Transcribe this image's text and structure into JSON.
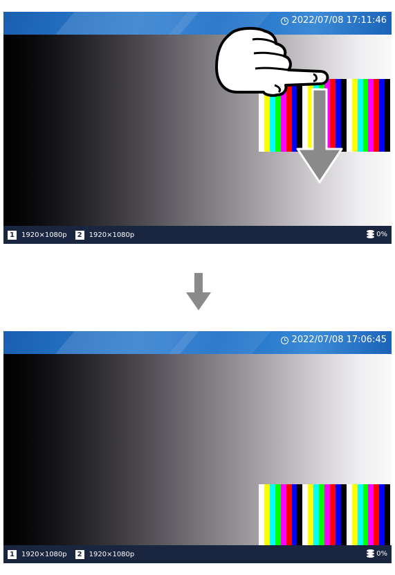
{
  "top_screen": {
    "datetime": "2022/07/08 17:11:46",
    "footer": {
      "channel1_badge": "1",
      "channel1_resolution": "1920×1080p",
      "channel2_badge": "2",
      "channel2_resolution": "1920×1080p",
      "storage_percent": "0%"
    }
  },
  "bottom_screen": {
    "datetime": "2022/07/08 17:06:45",
    "footer": {
      "channel1_badge": "1",
      "channel1_resolution": "1920×1080p",
      "channel2_badge": "2",
      "channel2_resolution": "1920×1080p",
      "storage_percent": "0%"
    }
  },
  "icons": {
    "clock": "clock-icon",
    "storage": "database-icon",
    "gesture": "hand-pointer-icon",
    "swipe_direction": "arrow-down-icon",
    "transition": "arrow-down-icon"
  },
  "colors": {
    "header_blue": "#1f6fc7",
    "footer_navy": "#1a2540",
    "color_bars": [
      "#ffffff",
      "#ffff00",
      "#00ffff",
      "#00ff00",
      "#ff00ff",
      "#ff0000",
      "#0000ff",
      "#000000"
    ]
  }
}
